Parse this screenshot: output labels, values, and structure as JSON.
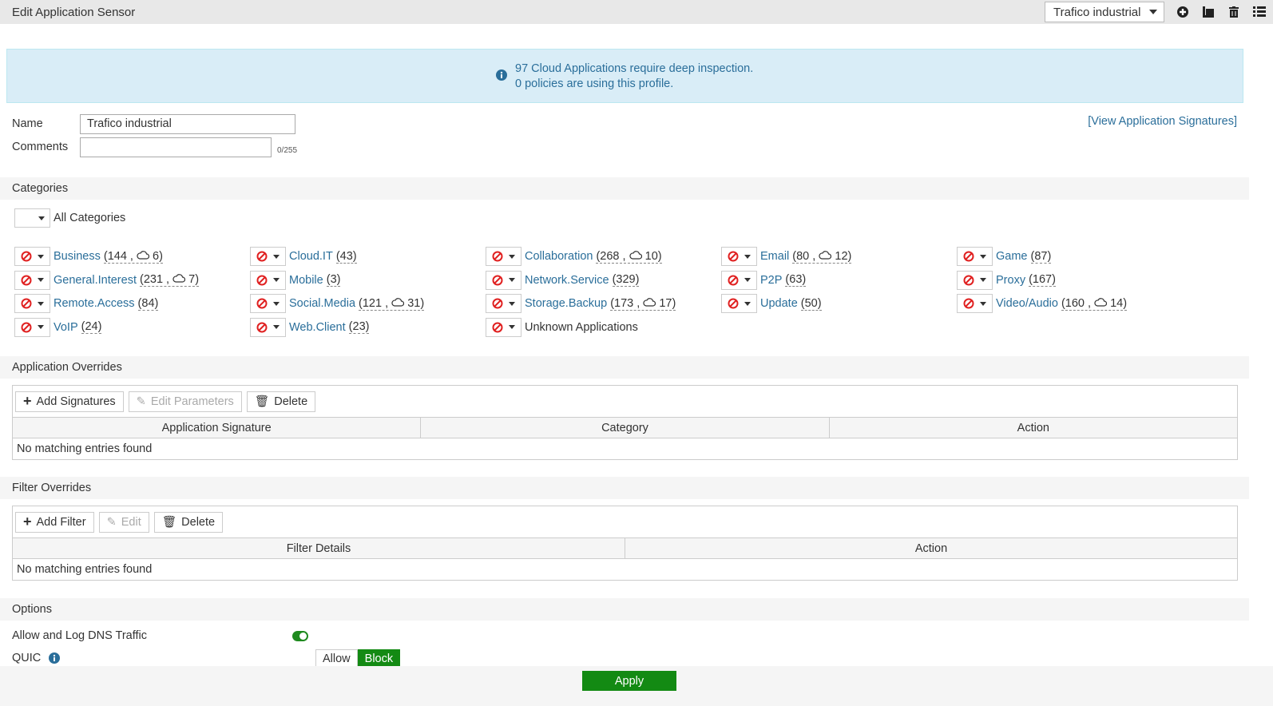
{
  "header": {
    "title": "Edit Application Sensor",
    "profile_select": "Trafico industrial",
    "icons": [
      "plus-circle-icon",
      "clone-icon",
      "trash-icon",
      "list-icon"
    ]
  },
  "banner": {
    "line1": "97 Cloud Applications require deep inspection.",
    "line2": "0 policies are using this profile."
  },
  "form": {
    "name_label": "Name",
    "name_value": "Trafico industrial",
    "comments_label": "Comments",
    "comments_value": "",
    "comments_count": "0/255",
    "view_signatures_link": "[View Application Signatures]"
  },
  "categories": {
    "title": "Categories",
    "all_label": "All Categories",
    "items": [
      {
        "name": "Business",
        "count": "144",
        "cloud": "6"
      },
      {
        "name": "Cloud.IT",
        "count": "43"
      },
      {
        "name": "Collaboration",
        "count": "268",
        "cloud": "10"
      },
      {
        "name": "Email",
        "count": "80",
        "cloud": "12"
      },
      {
        "name": "Game",
        "count": "87"
      },
      {
        "name": "General.Interest",
        "count": "231",
        "cloud": "7"
      },
      {
        "name": "Mobile",
        "count": "3"
      },
      {
        "name": "Network.Service",
        "count": "329"
      },
      {
        "name": "P2P",
        "count": "63"
      },
      {
        "name": "Proxy",
        "count": "167"
      },
      {
        "name": "Remote.Access",
        "count": "84"
      },
      {
        "name": "Social.Media",
        "count": "121",
        "cloud": "31"
      },
      {
        "name": "Storage.Backup",
        "count": "173",
        "cloud": "17"
      },
      {
        "name": "Update",
        "count": "50"
      },
      {
        "name": "Video/Audio",
        "count": "160",
        "cloud": "14"
      },
      {
        "name": "VoIP",
        "count": "24"
      },
      {
        "name": "Web.Client",
        "count": "23"
      },
      {
        "name": "Unknown Applications",
        "plain": true
      }
    ],
    "action_icon": "block-icon",
    "action_color": "#e02020"
  },
  "app_overrides": {
    "title": "Application Overrides",
    "add": "Add Signatures",
    "edit": "Edit Parameters",
    "delete": "Delete",
    "columns": [
      "Application Signature",
      "Category",
      "Action"
    ],
    "empty": "No matching entries found"
  },
  "filter_overrides": {
    "title": "Filter Overrides",
    "add": "Add Filter",
    "edit": "Edit",
    "delete": "Delete",
    "columns": [
      "Filter Details",
      "Action"
    ],
    "empty": "No matching entries found"
  },
  "options": {
    "title": "Options",
    "dns_label": "Allow and Log DNS Traffic",
    "dns_enabled": true,
    "quic_label": "QUIC",
    "quic_options": [
      "Allow",
      "Block"
    ],
    "quic_selected": "Block"
  },
  "apply": "Apply",
  "colors": {
    "accent_green": "#138a13",
    "link": "#2a6e9a",
    "block_red": "#e02020"
  }
}
